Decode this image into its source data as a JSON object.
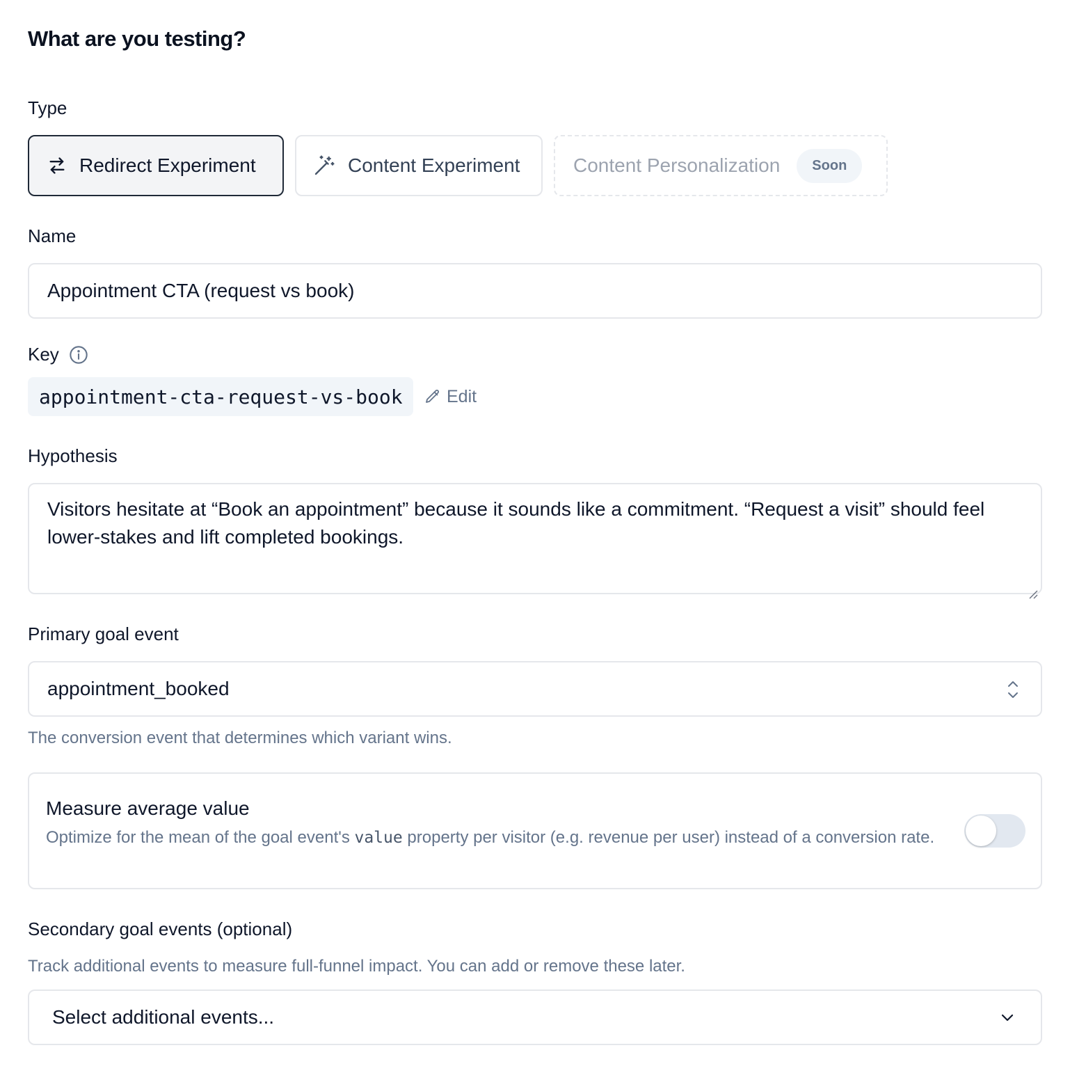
{
  "page": {
    "title": "What are you testing?"
  },
  "type_section": {
    "label": "Type",
    "options": [
      {
        "label": "Redirect Experiment",
        "icon": "arrows-swap-icon",
        "selected": true
      },
      {
        "label": "Content Experiment",
        "icon": "magic-wand-icon",
        "selected": false
      },
      {
        "label": "Content Personalization",
        "badge": "Soon",
        "disabled": true
      }
    ]
  },
  "name_field": {
    "label": "Name",
    "value": "Appointment CTA (request vs book)"
  },
  "key_field": {
    "label": "Key",
    "info_icon": "info-icon",
    "value": "appointment-cta-request-vs-book",
    "edit_label": "Edit"
  },
  "hypothesis_field": {
    "label": "Hypothesis",
    "value": "Visitors hesitate at “Book an appointment” because it sounds like a commitment. “Request a visit” should feel lower-stakes and lift completed bookings."
  },
  "primary_goal": {
    "label": "Primary goal event",
    "value": "appointment_booked",
    "helper": "The conversion event that determines which variant wins."
  },
  "average_value": {
    "title": "Measure average value",
    "desc_before": "Optimize for the mean of the goal event's ",
    "desc_code": "value",
    "desc_after": " property per visitor (e.g. revenue per user) instead of a conversion rate.",
    "enabled": false
  },
  "secondary_goals": {
    "label": "Secondary goal events (optional)",
    "helper": "Track additional events to measure full-funnel impact. You can add or remove these later.",
    "placeholder": "Select additional events..."
  },
  "colors": {
    "text": "#0f172a",
    "muted": "#64748b",
    "border": "#e5e7eb",
    "selected_border": "#1f2937",
    "selected_bg": "#f3f4f6"
  }
}
